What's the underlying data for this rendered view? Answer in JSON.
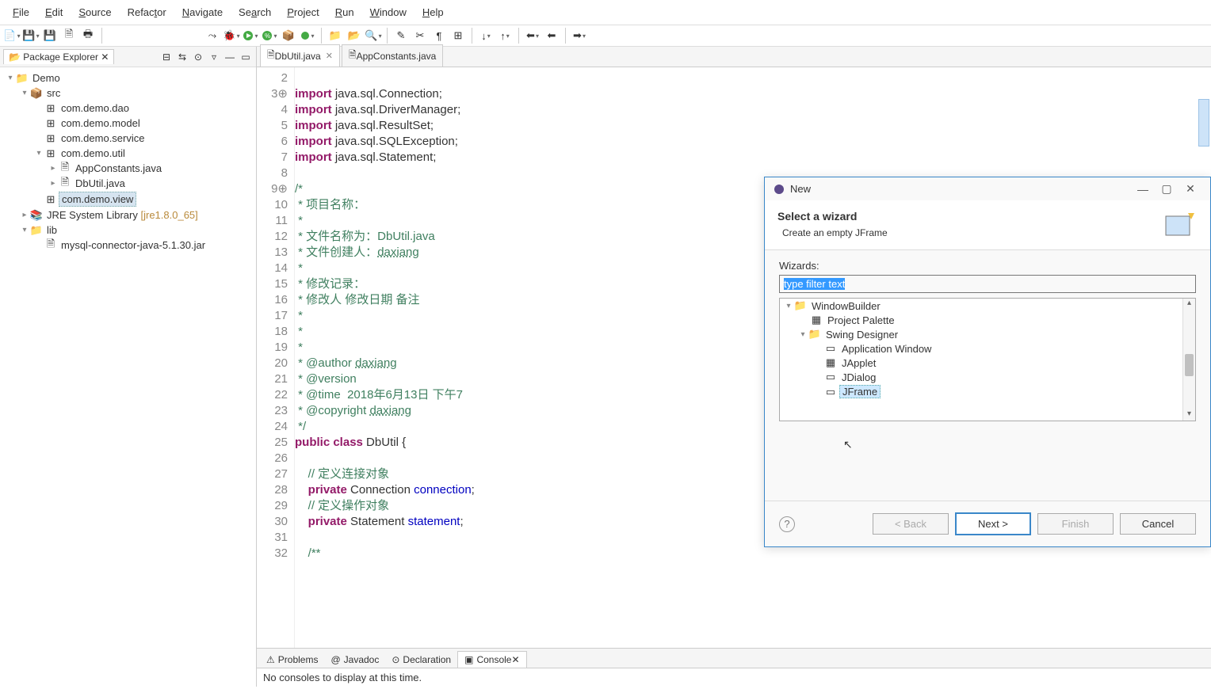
{
  "menubar": [
    "File",
    "Edit",
    "Source",
    "Refactor",
    "Navigate",
    "Search",
    "Project",
    "Run",
    "Window",
    "Help"
  ],
  "menubar_mn": [
    "F",
    "E",
    "S",
    "t",
    "N",
    "a",
    "P",
    "R",
    "W",
    "H"
  ],
  "pane": {
    "title": "Package Explorer"
  },
  "tree": {
    "root": "Demo",
    "src": "src",
    "packages": [
      "com.demo.dao",
      "com.demo.model",
      "com.demo.service",
      "com.demo.util"
    ],
    "util_children": [
      "AppConstants.java",
      "DbUtil.java"
    ],
    "view_pkg": "com.demo.view",
    "jre": "JRE System Library",
    "jre_suffix": "[jre1.8.0_65]",
    "lib": "lib",
    "lib_children": [
      "mysql-connector-java-5.1.30.jar"
    ]
  },
  "tabs": {
    "active": "DbUtil.java",
    "inactive": "AppConstants.java"
  },
  "code": {
    "first_line_no": 2,
    "lines": [
      {
        "n": "2",
        "t": ""
      },
      {
        "n": "3",
        "t": "import java.sql.Connection;",
        "kw": "import",
        "splash": true
      },
      {
        "n": "4",
        "t": "import java.sql.DriverManager;",
        "kw": "import"
      },
      {
        "n": "5",
        "t": "import java.sql.ResultSet;",
        "kw": "import"
      },
      {
        "n": "6",
        "t": "import java.sql.SQLException;",
        "kw": "import"
      },
      {
        "n": "7",
        "t": "import java.sql.Statement;",
        "kw": "import"
      },
      {
        "n": "8",
        "t": ""
      },
      {
        "n": "9",
        "t": "/*",
        "cm": true,
        "splash": true
      },
      {
        "n": "10",
        "t": " * 项目名称：",
        "cm": true
      },
      {
        "n": "11",
        "t": " *",
        "cm": true
      },
      {
        "n": "12",
        "t": " * 文件名称为：DbUtil.java",
        "cm": true
      },
      {
        "n": "13",
        "t": " * 文件创建人：daxiang",
        "cm": true,
        "link": "daxiang"
      },
      {
        "n": "14",
        "t": " *",
        "cm": true
      },
      {
        "n": "15",
        "t": " * 修改记录：",
        "cm": true
      },
      {
        "n": "16",
        "t": " * 修改人 修改日期 备注",
        "cm": true
      },
      {
        "n": "17",
        "t": " *",
        "cm": true
      },
      {
        "n": "18",
        "t": " *",
        "cm": true
      },
      {
        "n": "19",
        "t": " *",
        "cm": true
      },
      {
        "n": "20",
        "t": " * @author daxiang",
        "cm": true,
        "link": "daxiang"
      },
      {
        "n": "21",
        "t": " * @version",
        "cm": true
      },
      {
        "n": "22",
        "t": " * @time  2018年6月13日 下午7",
        "cm": true
      },
      {
        "n": "23",
        "t": " * @copyright daxiang",
        "cm": true,
        "link": "daxiang"
      },
      {
        "n": "24",
        "t": " */",
        "cm": true
      },
      {
        "n": "25",
        "t": "public class DbUtil {",
        "kw2": [
          "public",
          "class"
        ]
      },
      {
        "n": "26",
        "t": ""
      },
      {
        "n": "27",
        "t": "    // 定义连接对象",
        "cm": true
      },
      {
        "n": "28",
        "t": "    private Connection connection;",
        "kw": "private",
        "fld": "connection"
      },
      {
        "n": "29",
        "t": "    // 定义操作对象",
        "cm": true,
        "mark": true
      },
      {
        "n": "30",
        "t": "    private Statement statement;",
        "kw": "private",
        "fld": "statement"
      },
      {
        "n": "31",
        "t": ""
      },
      {
        "n": "32",
        "t": "    /**",
        "cm": true
      }
    ]
  },
  "bottom_tabs": {
    "items": [
      "Problems",
      "Javadoc",
      "Declaration",
      "Console"
    ],
    "active": 3
  },
  "console_msg": "No consoles to display at this time.",
  "dialog": {
    "title": "New",
    "heading": "Select a wizard",
    "desc": "Create an empty JFrame",
    "wizards_label": "Wizards:",
    "filter_text": "type filter text",
    "tree": {
      "root": "WindowBuilder",
      "child1": "Project Palette",
      "designer": "Swing Designer",
      "leaves": [
        "Application Window",
        "JApplet",
        "JDialog",
        "JFrame"
      ]
    },
    "buttons": {
      "back": "< Back",
      "next": "Next >",
      "finish": "Finish",
      "cancel": "Cancel"
    }
  }
}
